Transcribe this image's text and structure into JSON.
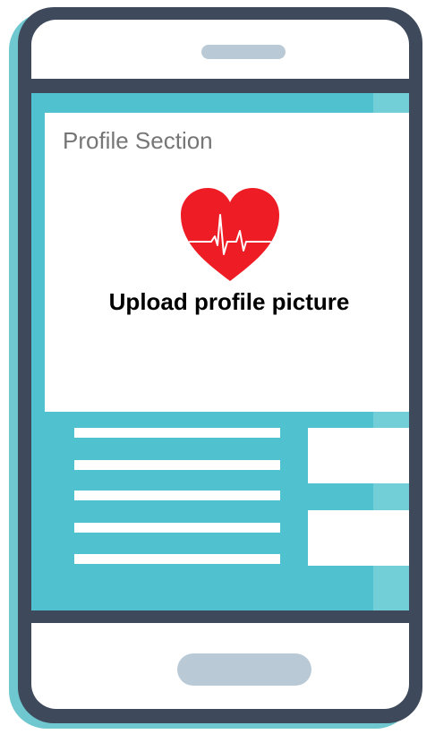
{
  "profile": {
    "title": "Profile Section",
    "upload_label": "Upload profile picture",
    "icon": "heart-pulse-icon"
  },
  "colors": {
    "phone_body": "#3e4a5c",
    "screen": "#4fc1cf",
    "screen_stripe": "#72ced7",
    "heart": "#ee1c25",
    "button": "#b9c9d5"
  },
  "list_lines": 5,
  "side_boxes": 2
}
